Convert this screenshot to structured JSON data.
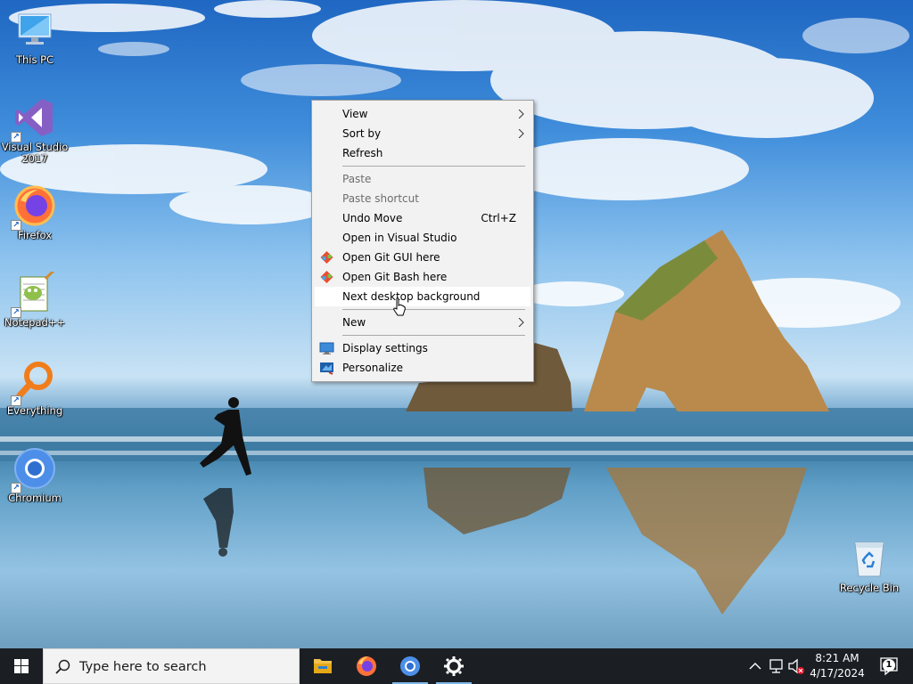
{
  "desktop": {
    "icons": [
      {
        "name": "This PC",
        "icon": "this-pc-icon"
      },
      {
        "name": "Visual Studio\n2017",
        "icon": "visual-studio-icon"
      },
      {
        "name": "Firefox",
        "icon": "firefox-icon"
      },
      {
        "name": "Notepad++",
        "icon": "notepadpp-icon"
      },
      {
        "name": "Everything",
        "icon": "everything-icon"
      },
      {
        "name": "Chromium",
        "icon": "chromium-icon"
      },
      {
        "name": "Recycle Bin",
        "icon": "recycle-bin-icon"
      }
    ]
  },
  "context_menu": {
    "items": [
      {
        "label": "View",
        "submenu": true
      },
      {
        "label": "Sort by",
        "submenu": true
      },
      {
        "label": "Refresh"
      },
      {
        "label": "Paste",
        "disabled": true
      },
      {
        "label": "Paste shortcut",
        "disabled": true
      },
      {
        "label": "Undo Move",
        "shortcut": "Ctrl+Z"
      },
      {
        "label": "Open in Visual Studio"
      },
      {
        "label": "Open Git GUI here",
        "icon": "git-icon"
      },
      {
        "label": "Open Git Bash here",
        "icon": "git-icon"
      },
      {
        "label": "Next desktop background",
        "hovered": true
      },
      {
        "label": "New",
        "submenu": true
      },
      {
        "label": "Display settings",
        "icon": "display-icon"
      },
      {
        "label": "Personalize",
        "icon": "personalize-icon"
      }
    ]
  },
  "taskbar": {
    "search_placeholder": "Type here to search",
    "pinned": [
      "file-explorer-icon",
      "firefox-icon",
      "chromium-icon",
      "settings-icon"
    ],
    "clock": {
      "time": "8:21 AM",
      "date": "4/17/2024"
    },
    "notification_count": "1"
  },
  "colors": {
    "menu_bg": "#f2f2f2",
    "taskbar_bg": "#1b1f24",
    "accent": "#0078d7"
  }
}
